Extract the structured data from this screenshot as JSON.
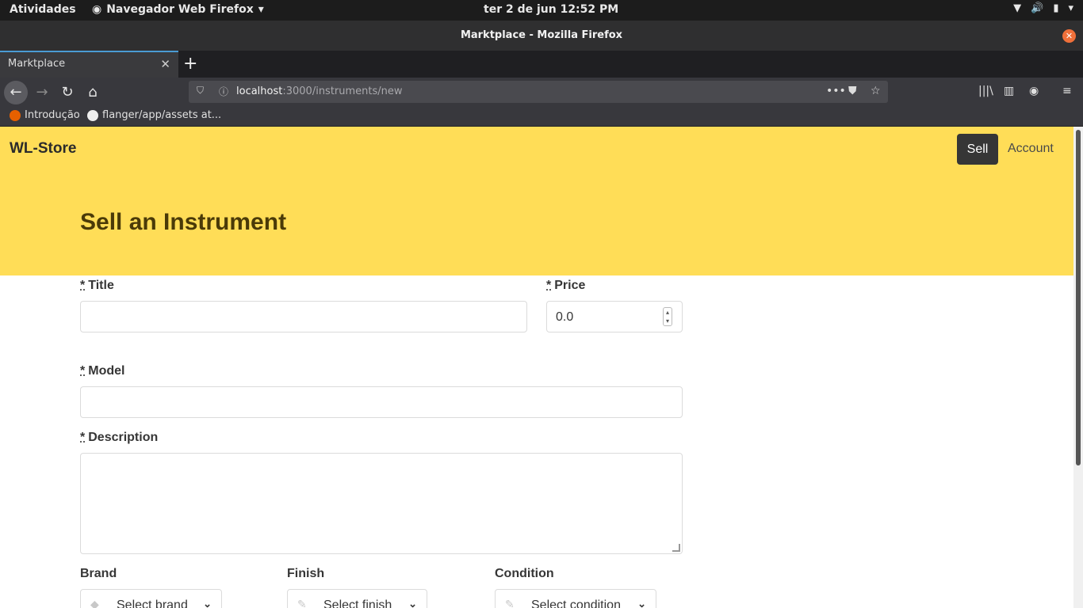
{
  "system": {
    "activities": "Atividades",
    "app_menu": "Navegador Web Firefox",
    "clock": "ter 2 de jun  12:52 PM"
  },
  "window": {
    "title": "Marktplace - Mozilla Firefox"
  },
  "tabs": [
    {
      "label": "Marktplace"
    }
  ],
  "urlbar": {
    "host": "localhost",
    "path": ":3000/instruments/new"
  },
  "bookmarks": [
    {
      "label": "Introdução",
      "icon": "firefox-icon"
    },
    {
      "label": "flanger/app/assets at...",
      "icon": "github-icon"
    }
  ],
  "navbar": {
    "brand": "WL-Store",
    "sell": "Sell",
    "account": "Account"
  },
  "hero": {
    "title": "Sell an Instrument"
  },
  "form": {
    "required_mark": "*",
    "title_label": "Title",
    "title_value": "",
    "price_label": "Price",
    "price_value": "0.0",
    "model_label": "Model",
    "model_value": "",
    "description_label": "Description",
    "description_value": "",
    "brand_label": "Brand",
    "brand_select": "Select brand",
    "finish_label": "Finish",
    "finish_select": "Select finish",
    "condition_label": "Condition",
    "condition_select": "Select condition"
  },
  "colors": {
    "hero_bg": "#ffdd57",
    "button_dark": "#363636"
  }
}
